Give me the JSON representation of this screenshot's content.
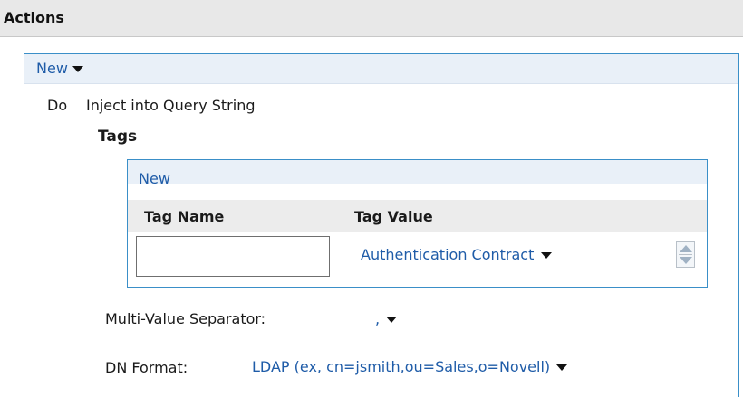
{
  "section": {
    "title": "Actions"
  },
  "toolbar": {
    "new_label": "New"
  },
  "action": {
    "do_label": "Do",
    "name": "Inject into Query String",
    "tags_label": "Tags"
  },
  "tags_table": {
    "new_label": "New",
    "columns": [
      "Tag Name",
      "Tag Value"
    ],
    "rows": [
      {
        "tag_name": "",
        "tag_value": "Authentication Contract"
      }
    ]
  },
  "fields": {
    "separator_label": "Multi-Value Separator:",
    "separator_value": ",",
    "dn_format_label": "DN Format:",
    "dn_format_value": "LDAP (ex, cn=jsmith,ou=Sales,o=Novell)"
  },
  "colors": {
    "accent_border": "#3a8fc8",
    "link": "#1f5ca8",
    "header_bg": "#e8e8e8",
    "toolbar_bg": "#e9f0f8"
  },
  "icons": {
    "dropdown": "chevron-down-icon",
    "move_row": "up-down-arrows-icon"
  }
}
